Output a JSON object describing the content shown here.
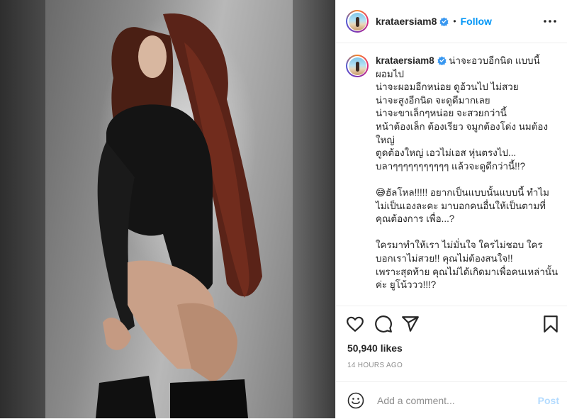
{
  "post": {
    "username": "krataersiam8",
    "verified": true,
    "follow_label": "Follow",
    "separator": "•",
    "caption_lines": [
      "น่าจะอวบอีกนิด แบบนี้",
      "ผอมไป",
      "น่าจะผอมอีกหน่อย ดูอ้วนไป ไม่สวย",
      "น่าจะสูงอีกนิด จะดูดีมากเลย",
      "น่าจะขาเล็กๆหน่อย จะสวยกว่านี้",
      "หน้าต้องเล็ก ต้องเรียว จมูกต้องโด่ง นมต้อง",
      "ใหญ่",
      "ตูดต้องใหญ่ เอวไม่เอส หุ่นตรงไป...",
      "บลาๆๆๆๆๆๆๆๆๆๆๆ แล้วจะดูดีกว่านี้!!?",
      "",
      "😅ฮัลโหล!!!!! อยากเป็นแบบนั้นแบบนี้ ทำไม",
      "ไม่เป็นเองละคะ มาบอกคนอื่นให้เป็นตามที่",
      "คุณต้องการ เพื่อ...?",
      "",
      "ใครมาทำให้เรา ไม่มั่นใจ ใครไม่ชอบ ใคร",
      "บอกเราไม่สวย!! คุณไม่ต้องสนใจ!!",
      "เพราะสุดท้าย คุณไม่ได้เกิดมาเพื่อคนเหล่านั้น",
      "ค่ะ ยูโน้ววว!!!?"
    ],
    "likes": "50,940 likes",
    "time_ago": "14 HOURS AGO"
  },
  "icons": {
    "like": "heart-icon",
    "comment": "comment-icon",
    "share": "paper-plane-icon",
    "save": "bookmark-icon",
    "emoji": "smiley-icon",
    "more": "more-options-icon",
    "verified": "verified-badge-icon"
  },
  "comment_box": {
    "placeholder": "Add a comment...",
    "post_label": "Post"
  },
  "colors": {
    "accent": "#0095f6",
    "post_disabled": "#b3dbff",
    "muted": "#8e8e8e",
    "text": "#262626"
  }
}
